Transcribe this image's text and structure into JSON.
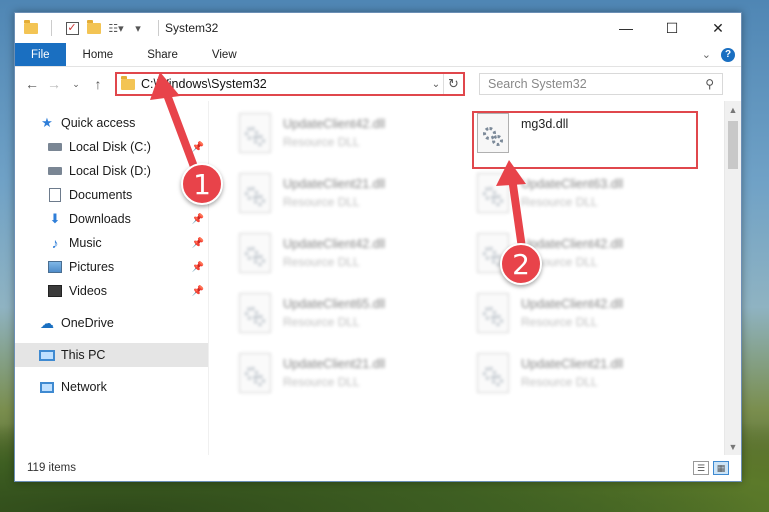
{
  "window": {
    "title": "System32",
    "controls": {
      "minimize": "—",
      "maximize": "☐",
      "close": "✕"
    }
  },
  "ribbon": {
    "tabs": [
      "File",
      "Home",
      "Share",
      "View"
    ],
    "expand_icon": "chevron-down-icon",
    "help_label": "?"
  },
  "address": {
    "path": "C:\\Windows\\System32",
    "search_placeholder": "Search System32"
  },
  "nav": {
    "items": [
      {
        "label": "Quick access",
        "icon": "star-icon",
        "pinned": false
      },
      {
        "label": "Local Disk (C:)",
        "icon": "drive-icon",
        "pinned": true
      },
      {
        "label": "Local Disk (D:)",
        "icon": "drive-icon",
        "pinned": false
      },
      {
        "label": "Documents",
        "icon": "documents-icon",
        "pinned": false
      },
      {
        "label": "Downloads",
        "icon": "downloads-icon",
        "pinned": true
      },
      {
        "label": "Music",
        "icon": "music-icon",
        "pinned": true
      },
      {
        "label": "Pictures",
        "icon": "pictures-icon",
        "pinned": true
      },
      {
        "label": "Videos",
        "icon": "videos-icon",
        "pinned": true
      },
      {
        "label": "OneDrive",
        "icon": "onedrive-icon",
        "pinned": false
      },
      {
        "label": "This PC",
        "icon": "this-pc-icon",
        "pinned": false,
        "selected": true
      },
      {
        "label": "Network",
        "icon": "network-icon",
        "pinned": false
      }
    ]
  },
  "files": {
    "highlighted": {
      "name": "mg3d.dll",
      "type": ""
    },
    "left_column": [
      {
        "name": "UpdateClient42.dll",
        "type": "Resource DLL"
      },
      {
        "name": "UpdateClient21.dll",
        "type": "Resource DLL"
      },
      {
        "name": "UpdateClient42.dll",
        "type": "Resource DLL"
      },
      {
        "name": "UpdateClient65.dll",
        "type": "Resource DLL"
      },
      {
        "name": "UpdateClient21.dll",
        "type": "Resource DLL"
      }
    ],
    "right_column": [
      {
        "name": "UpdateClient63.dll",
        "type": "Resource DLL"
      },
      {
        "name": "UpdateClient42.dll",
        "type": "Resource DLL"
      },
      {
        "name": "UpdateClient42.dll",
        "type": "Resource DLL"
      },
      {
        "name": "UpdateClient21.dll",
        "type": "Resource DLL"
      }
    ]
  },
  "status": {
    "item_count": "119 items"
  },
  "annotations": {
    "step1": "1",
    "step2": "2",
    "color": "#e8434a"
  }
}
